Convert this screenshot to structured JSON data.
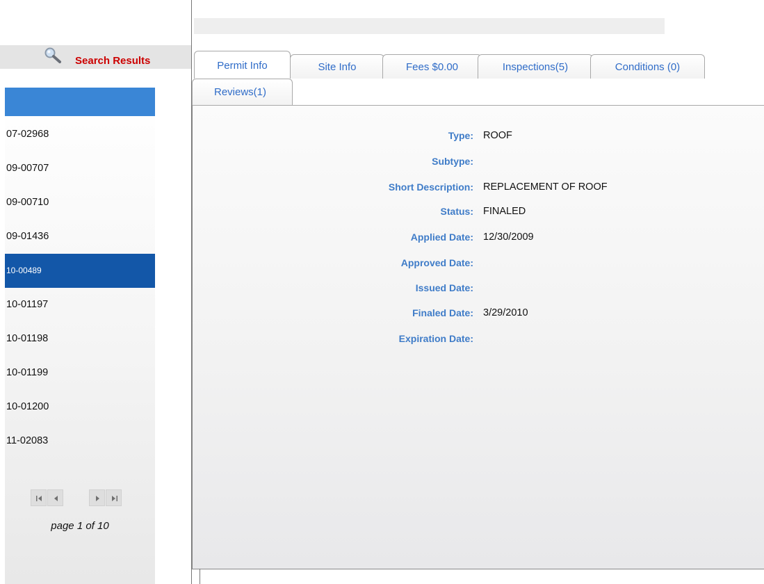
{
  "sidebar": {
    "search_label": "Search Results",
    "results": [
      "07-02968",
      "09-00707",
      "09-00710",
      "09-01436",
      "10-00489",
      "10-01197",
      "10-01198",
      "10-01199",
      "10-01200",
      "11-02083"
    ],
    "selected_index": 4,
    "page_info": "page 1 of 10"
  },
  "tabs": [
    {
      "label": "Permit Info",
      "active": true
    },
    {
      "label": "Site Info",
      "active": false
    },
    {
      "label": "Fees $0.00",
      "active": false
    },
    {
      "label": "Inspections(5)",
      "active": false
    },
    {
      "label": "Conditions (0)",
      "active": false
    },
    {
      "label": "Reviews(1)",
      "active": false
    }
  ],
  "permit": {
    "fields": [
      {
        "label": "Type:",
        "value": "ROOF"
      },
      {
        "label": "Subtype:",
        "value": ""
      },
      {
        "label": "Short Description:",
        "value": "REPLACEMENT OF ROOF"
      },
      {
        "label": "Status:",
        "value": "FINALED"
      },
      {
        "label": "Applied Date:",
        "value": "12/30/2009"
      },
      {
        "label": "Approved Date:",
        "value": ""
      },
      {
        "label": "Issued Date:",
        "value": ""
      },
      {
        "label": "Finaled Date:",
        "value": "3/29/2010"
      },
      {
        "label": "Expiration Date:",
        "value": ""
      }
    ]
  },
  "colors": {
    "accent_blue": "#3a86d6",
    "selected_row": "#1357a8",
    "label_blue": "#3f7cc8",
    "search_red": "#cc0000"
  }
}
